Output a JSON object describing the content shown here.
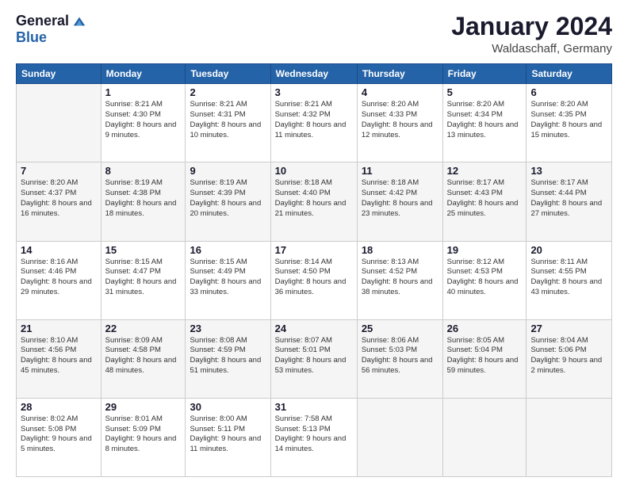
{
  "logo": {
    "general": "General",
    "blue": "Blue"
  },
  "header": {
    "month": "January 2024",
    "location": "Waldaschaff, Germany"
  },
  "weekdays": [
    "Sunday",
    "Monday",
    "Tuesday",
    "Wednesday",
    "Thursday",
    "Friday",
    "Saturday"
  ],
  "weeks": [
    [
      {
        "day": "",
        "sunrise": "",
        "sunset": "",
        "daylight": ""
      },
      {
        "day": "1",
        "sunrise": "Sunrise: 8:21 AM",
        "sunset": "Sunset: 4:30 PM",
        "daylight": "Daylight: 8 hours and 9 minutes."
      },
      {
        "day": "2",
        "sunrise": "Sunrise: 8:21 AM",
        "sunset": "Sunset: 4:31 PM",
        "daylight": "Daylight: 8 hours and 10 minutes."
      },
      {
        "day": "3",
        "sunrise": "Sunrise: 8:21 AM",
        "sunset": "Sunset: 4:32 PM",
        "daylight": "Daylight: 8 hours and 11 minutes."
      },
      {
        "day": "4",
        "sunrise": "Sunrise: 8:20 AM",
        "sunset": "Sunset: 4:33 PM",
        "daylight": "Daylight: 8 hours and 12 minutes."
      },
      {
        "day": "5",
        "sunrise": "Sunrise: 8:20 AM",
        "sunset": "Sunset: 4:34 PM",
        "daylight": "Daylight: 8 hours and 13 minutes."
      },
      {
        "day": "6",
        "sunrise": "Sunrise: 8:20 AM",
        "sunset": "Sunset: 4:35 PM",
        "daylight": "Daylight: 8 hours and 15 minutes."
      }
    ],
    [
      {
        "day": "7",
        "sunrise": "Sunrise: 8:20 AM",
        "sunset": "Sunset: 4:37 PM",
        "daylight": "Daylight: 8 hours and 16 minutes."
      },
      {
        "day": "8",
        "sunrise": "Sunrise: 8:19 AM",
        "sunset": "Sunset: 4:38 PM",
        "daylight": "Daylight: 8 hours and 18 minutes."
      },
      {
        "day": "9",
        "sunrise": "Sunrise: 8:19 AM",
        "sunset": "Sunset: 4:39 PM",
        "daylight": "Daylight: 8 hours and 20 minutes."
      },
      {
        "day": "10",
        "sunrise": "Sunrise: 8:18 AM",
        "sunset": "Sunset: 4:40 PM",
        "daylight": "Daylight: 8 hours and 21 minutes."
      },
      {
        "day": "11",
        "sunrise": "Sunrise: 8:18 AM",
        "sunset": "Sunset: 4:42 PM",
        "daylight": "Daylight: 8 hours and 23 minutes."
      },
      {
        "day": "12",
        "sunrise": "Sunrise: 8:17 AM",
        "sunset": "Sunset: 4:43 PM",
        "daylight": "Daylight: 8 hours and 25 minutes."
      },
      {
        "day": "13",
        "sunrise": "Sunrise: 8:17 AM",
        "sunset": "Sunset: 4:44 PM",
        "daylight": "Daylight: 8 hours and 27 minutes."
      }
    ],
    [
      {
        "day": "14",
        "sunrise": "Sunrise: 8:16 AM",
        "sunset": "Sunset: 4:46 PM",
        "daylight": "Daylight: 8 hours and 29 minutes."
      },
      {
        "day": "15",
        "sunrise": "Sunrise: 8:15 AM",
        "sunset": "Sunset: 4:47 PM",
        "daylight": "Daylight: 8 hours and 31 minutes."
      },
      {
        "day": "16",
        "sunrise": "Sunrise: 8:15 AM",
        "sunset": "Sunset: 4:49 PM",
        "daylight": "Daylight: 8 hours and 33 minutes."
      },
      {
        "day": "17",
        "sunrise": "Sunrise: 8:14 AM",
        "sunset": "Sunset: 4:50 PM",
        "daylight": "Daylight: 8 hours and 36 minutes."
      },
      {
        "day": "18",
        "sunrise": "Sunrise: 8:13 AM",
        "sunset": "Sunset: 4:52 PM",
        "daylight": "Daylight: 8 hours and 38 minutes."
      },
      {
        "day": "19",
        "sunrise": "Sunrise: 8:12 AM",
        "sunset": "Sunset: 4:53 PM",
        "daylight": "Daylight: 8 hours and 40 minutes."
      },
      {
        "day": "20",
        "sunrise": "Sunrise: 8:11 AM",
        "sunset": "Sunset: 4:55 PM",
        "daylight": "Daylight: 8 hours and 43 minutes."
      }
    ],
    [
      {
        "day": "21",
        "sunrise": "Sunrise: 8:10 AM",
        "sunset": "Sunset: 4:56 PM",
        "daylight": "Daylight: 8 hours and 45 minutes."
      },
      {
        "day": "22",
        "sunrise": "Sunrise: 8:09 AM",
        "sunset": "Sunset: 4:58 PM",
        "daylight": "Daylight: 8 hours and 48 minutes."
      },
      {
        "day": "23",
        "sunrise": "Sunrise: 8:08 AM",
        "sunset": "Sunset: 4:59 PM",
        "daylight": "Daylight: 8 hours and 51 minutes."
      },
      {
        "day": "24",
        "sunrise": "Sunrise: 8:07 AM",
        "sunset": "Sunset: 5:01 PM",
        "daylight": "Daylight: 8 hours and 53 minutes."
      },
      {
        "day": "25",
        "sunrise": "Sunrise: 8:06 AM",
        "sunset": "Sunset: 5:03 PM",
        "daylight": "Daylight: 8 hours and 56 minutes."
      },
      {
        "day": "26",
        "sunrise": "Sunrise: 8:05 AM",
        "sunset": "Sunset: 5:04 PM",
        "daylight": "Daylight: 8 hours and 59 minutes."
      },
      {
        "day": "27",
        "sunrise": "Sunrise: 8:04 AM",
        "sunset": "Sunset: 5:06 PM",
        "daylight": "Daylight: 9 hours and 2 minutes."
      }
    ],
    [
      {
        "day": "28",
        "sunrise": "Sunrise: 8:02 AM",
        "sunset": "Sunset: 5:08 PM",
        "daylight": "Daylight: 9 hours and 5 minutes."
      },
      {
        "day": "29",
        "sunrise": "Sunrise: 8:01 AM",
        "sunset": "Sunset: 5:09 PM",
        "daylight": "Daylight: 9 hours and 8 minutes."
      },
      {
        "day": "30",
        "sunrise": "Sunrise: 8:00 AM",
        "sunset": "Sunset: 5:11 PM",
        "daylight": "Daylight: 9 hours and 11 minutes."
      },
      {
        "day": "31",
        "sunrise": "Sunrise: 7:58 AM",
        "sunset": "Sunset: 5:13 PM",
        "daylight": "Daylight: 9 hours and 14 minutes."
      },
      {
        "day": "",
        "sunrise": "",
        "sunset": "",
        "daylight": ""
      },
      {
        "day": "",
        "sunrise": "",
        "sunset": "",
        "daylight": ""
      },
      {
        "day": "",
        "sunrise": "",
        "sunset": "",
        "daylight": ""
      }
    ]
  ]
}
